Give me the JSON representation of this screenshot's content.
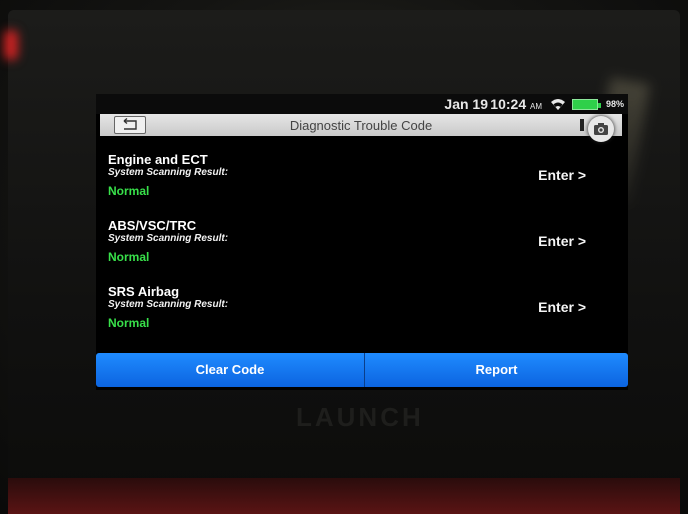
{
  "status": {
    "date": "Jan 19",
    "time": "10:24",
    "ampm": "AM",
    "battery": "98%"
  },
  "header": {
    "title": "Diagnostic Trouble Code"
  },
  "systems": [
    {
      "name": "Engine and ECT",
      "subtitle": "System Scanning Result:",
      "status": "Normal",
      "action": "Enter >"
    },
    {
      "name": "ABS/VSC/TRC",
      "subtitle": "System Scanning Result:",
      "status": "Normal",
      "action": "Enter >"
    },
    {
      "name": "SRS Airbag",
      "subtitle": "System Scanning Result:",
      "status": "Normal",
      "action": "Enter >"
    }
  ],
  "footer": {
    "clear_label": "Clear Code",
    "report_label": "Report"
  },
  "device": {
    "brand": "LAUNCH"
  },
  "colors": {
    "accent": "#1f8bff",
    "normal": "#38e04a"
  },
  "icons": {
    "back": "back-arrow-icon",
    "camera": "camera-icon",
    "wifi": "wifi-icon",
    "battery": "battery-icon"
  }
}
